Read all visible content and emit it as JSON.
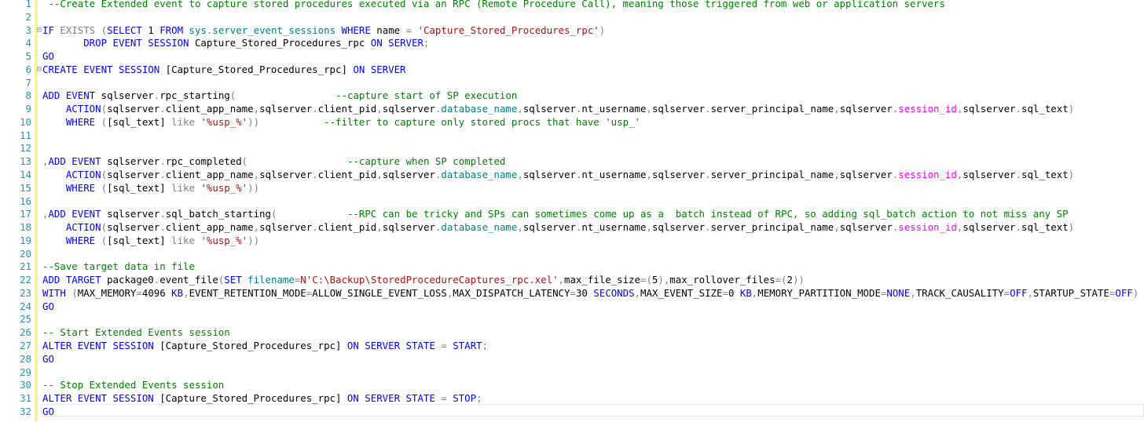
{
  "editor": {
    "lines": [
      {
        "n": "1",
        "parts": [
          {
            "t": " --Create Extended event to capture stored procedures executed via an RPC (Remote Procedure Call), meaning those triggered from web or application servers",
            "c": "cm"
          }
        ]
      },
      {
        "n": "2",
        "parts": []
      },
      {
        "n": "3",
        "fold": "⊟",
        "parts": [
          {
            "t": "IF ",
            "c": "kw"
          },
          {
            "t": "EXISTS ",
            "c": "gr"
          },
          {
            "t": "(",
            "c": "gr"
          },
          {
            "t": "SELECT ",
            "c": "kw"
          },
          {
            "t": "1 ",
            "c": ""
          },
          {
            "t": "FROM ",
            "c": "kw"
          },
          {
            "t": "sys",
            "c": "ob"
          },
          {
            "t": ".",
            "c": "gr"
          },
          {
            "t": "server_event_sessions ",
            "c": "ob"
          },
          {
            "t": "WHERE ",
            "c": "kw"
          },
          {
            "t": "name ",
            "c": ""
          },
          {
            "t": "= ",
            "c": "gr"
          },
          {
            "t": "'Capture_Stored_Procedures_rpc'",
            "c": "st"
          },
          {
            "t": ")",
            "c": "gr"
          }
        ]
      },
      {
        "n": "4",
        "parts": [
          {
            "t": "       DROP EVENT SESSION ",
            "c": "kw"
          },
          {
            "t": "Capture_Stored_Procedures_rpc ",
            "c": ""
          },
          {
            "t": "ON SERVER",
            "c": "kw"
          },
          {
            "t": ";",
            "c": "gr"
          }
        ]
      },
      {
        "n": "5",
        "parts": [
          {
            "t": "GO",
            "c": "kw"
          }
        ]
      },
      {
        "n": "6",
        "fold": "⊟",
        "parts": [
          {
            "t": "CREATE EVENT SESSION ",
            "c": "kw"
          },
          {
            "t": "[Capture_Stored_Procedures_rpc] ",
            "c": ""
          },
          {
            "t": "ON SERVER",
            "c": "kw"
          }
        ]
      },
      {
        "n": "7",
        "parts": []
      },
      {
        "n": "8",
        "parts": [
          {
            "t": "ADD EVENT ",
            "c": "kw"
          },
          {
            "t": "sqlserver",
            "c": ""
          },
          {
            "t": ".",
            "c": "gr"
          },
          {
            "t": "rpc_starting",
            "c": ""
          },
          {
            "t": "(",
            "c": "gr"
          },
          {
            "t": "                 ",
            "c": ""
          },
          {
            "t": "--capture start of SP execution",
            "c": "cm"
          }
        ]
      },
      {
        "n": "9",
        "parts": [
          {
            "t": "    ACTION",
            "c": "kw"
          },
          {
            "t": "(",
            "c": "gr"
          },
          {
            "t": "sqlserver",
            "c": ""
          },
          {
            "t": ".",
            "c": "gr"
          },
          {
            "t": "client_app_name",
            "c": ""
          },
          {
            "t": ",",
            "c": "gr"
          },
          {
            "t": "sqlserver",
            "c": ""
          },
          {
            "t": ".",
            "c": "gr"
          },
          {
            "t": "client_pid",
            "c": ""
          },
          {
            "t": ",",
            "c": "gr"
          },
          {
            "t": "sqlserver",
            "c": ""
          },
          {
            "t": ".",
            "c": "gr"
          },
          {
            "t": "database_name",
            "c": "ob"
          },
          {
            "t": ",",
            "c": "gr"
          },
          {
            "t": "sqlserver",
            "c": ""
          },
          {
            "t": ".",
            "c": "gr"
          },
          {
            "t": "nt_username",
            "c": ""
          },
          {
            "t": ",",
            "c": "gr"
          },
          {
            "t": "sqlserver",
            "c": ""
          },
          {
            "t": ".",
            "c": "gr"
          },
          {
            "t": "server_principal_name",
            "c": ""
          },
          {
            "t": ",",
            "c": "gr"
          },
          {
            "t": "sqlserver",
            "c": ""
          },
          {
            "t": ".",
            "c": "gr"
          },
          {
            "t": "session_id",
            "c": "fn"
          },
          {
            "t": ",",
            "c": "gr"
          },
          {
            "t": "sqlserver",
            "c": ""
          },
          {
            "t": ".",
            "c": "gr"
          },
          {
            "t": "sql_text",
            "c": ""
          },
          {
            "t": ")",
            "c": "gr"
          }
        ]
      },
      {
        "n": "10",
        "parts": [
          {
            "t": "    WHERE ",
            "c": "kw"
          },
          {
            "t": "(",
            "c": "gr"
          },
          {
            "t": "[sql_text] ",
            "c": ""
          },
          {
            "t": "like ",
            "c": "gr"
          },
          {
            "t": "'%usp_%'",
            "c": "st"
          },
          {
            "t": "))",
            "c": "gr"
          },
          {
            "t": "           ",
            "c": ""
          },
          {
            "t": "--filter to capture only stored procs that have 'usp_'",
            "c": "cm"
          }
        ]
      },
      {
        "n": "11",
        "parts": []
      },
      {
        "n": "12",
        "parts": []
      },
      {
        "n": "13",
        "parts": [
          {
            "t": ",",
            "c": "gr"
          },
          {
            "t": "ADD EVENT ",
            "c": "kw"
          },
          {
            "t": "sqlserver",
            "c": ""
          },
          {
            "t": ".",
            "c": "gr"
          },
          {
            "t": "rpc_completed",
            "c": ""
          },
          {
            "t": "(",
            "c": "gr"
          },
          {
            "t": "                 ",
            "c": ""
          },
          {
            "t": "--capture when SP completed",
            "c": "cm"
          }
        ]
      },
      {
        "n": "14",
        "parts": [
          {
            "t": "    ACTION",
            "c": "kw"
          },
          {
            "t": "(",
            "c": "gr"
          },
          {
            "t": "sqlserver",
            "c": ""
          },
          {
            "t": ".",
            "c": "gr"
          },
          {
            "t": "client_app_name",
            "c": ""
          },
          {
            "t": ",",
            "c": "gr"
          },
          {
            "t": "sqlserver",
            "c": ""
          },
          {
            "t": ".",
            "c": "gr"
          },
          {
            "t": "client_pid",
            "c": ""
          },
          {
            "t": ",",
            "c": "gr"
          },
          {
            "t": "sqlserver",
            "c": ""
          },
          {
            "t": ".",
            "c": "gr"
          },
          {
            "t": "database_name",
            "c": "ob"
          },
          {
            "t": ",",
            "c": "gr"
          },
          {
            "t": "sqlserver",
            "c": ""
          },
          {
            "t": ".",
            "c": "gr"
          },
          {
            "t": "nt_username",
            "c": ""
          },
          {
            "t": ",",
            "c": "gr"
          },
          {
            "t": "sqlserver",
            "c": ""
          },
          {
            "t": ".",
            "c": "gr"
          },
          {
            "t": "server_principal_name",
            "c": ""
          },
          {
            "t": ",",
            "c": "gr"
          },
          {
            "t": "sqlserver",
            "c": ""
          },
          {
            "t": ".",
            "c": "gr"
          },
          {
            "t": "session_id",
            "c": "fn"
          },
          {
            "t": ",",
            "c": "gr"
          },
          {
            "t": "sqlserver",
            "c": ""
          },
          {
            "t": ".",
            "c": "gr"
          },
          {
            "t": "sql_text",
            "c": ""
          },
          {
            "t": ")",
            "c": "gr"
          }
        ]
      },
      {
        "n": "15",
        "parts": [
          {
            "t": "    WHERE ",
            "c": "kw"
          },
          {
            "t": "(",
            "c": "gr"
          },
          {
            "t": "[sql_text] ",
            "c": ""
          },
          {
            "t": "like ",
            "c": "gr"
          },
          {
            "t": "'%usp_%'",
            "c": "st"
          },
          {
            "t": "))",
            "c": "gr"
          }
        ]
      },
      {
        "n": "16",
        "parts": []
      },
      {
        "n": "17",
        "parts": [
          {
            "t": ",",
            "c": "gr"
          },
          {
            "t": "ADD EVENT ",
            "c": "kw"
          },
          {
            "t": "sqlserver",
            "c": ""
          },
          {
            "t": ".",
            "c": "gr"
          },
          {
            "t": "sql_batch_starting",
            "c": ""
          },
          {
            "t": "(",
            "c": "gr"
          },
          {
            "t": "            ",
            "c": ""
          },
          {
            "t": "--RPC can be tricky and SPs can sometimes come up as a  batch instead of RPC, so adding sql_batch action to not miss any SP",
            "c": "cm"
          }
        ]
      },
      {
        "n": "18",
        "parts": [
          {
            "t": "    ACTION",
            "c": "kw"
          },
          {
            "t": "(",
            "c": "gr"
          },
          {
            "t": "sqlserver",
            "c": ""
          },
          {
            "t": ".",
            "c": "gr"
          },
          {
            "t": "client_app_name",
            "c": ""
          },
          {
            "t": ",",
            "c": "gr"
          },
          {
            "t": "sqlserver",
            "c": ""
          },
          {
            "t": ".",
            "c": "gr"
          },
          {
            "t": "client_pid",
            "c": ""
          },
          {
            "t": ",",
            "c": "gr"
          },
          {
            "t": "sqlserver",
            "c": ""
          },
          {
            "t": ".",
            "c": "gr"
          },
          {
            "t": "database_name",
            "c": "ob"
          },
          {
            "t": ",",
            "c": "gr"
          },
          {
            "t": "sqlserver",
            "c": ""
          },
          {
            "t": ".",
            "c": "gr"
          },
          {
            "t": "nt_username",
            "c": ""
          },
          {
            "t": ",",
            "c": "gr"
          },
          {
            "t": "sqlserver",
            "c": ""
          },
          {
            "t": ".",
            "c": "gr"
          },
          {
            "t": "server_principal_name",
            "c": ""
          },
          {
            "t": ",",
            "c": "gr"
          },
          {
            "t": "sqlserver",
            "c": ""
          },
          {
            "t": ".",
            "c": "gr"
          },
          {
            "t": "session_id",
            "c": "fn"
          },
          {
            "t": ",",
            "c": "gr"
          },
          {
            "t": "sqlserver",
            "c": ""
          },
          {
            "t": ".",
            "c": "gr"
          },
          {
            "t": "sql_text",
            "c": ""
          },
          {
            "t": ")",
            "c": "gr"
          }
        ]
      },
      {
        "n": "19",
        "parts": [
          {
            "t": "    WHERE ",
            "c": "kw"
          },
          {
            "t": "(",
            "c": "gr"
          },
          {
            "t": "[sql_text] ",
            "c": ""
          },
          {
            "t": "like ",
            "c": "gr"
          },
          {
            "t": "'%usp_%'",
            "c": "st"
          },
          {
            "t": "))",
            "c": "gr"
          }
        ]
      },
      {
        "n": "20",
        "parts": []
      },
      {
        "n": "21",
        "parts": [
          {
            "t": "--Save target data in file",
            "c": "cm"
          }
        ]
      },
      {
        "n": "22",
        "parts": [
          {
            "t": "ADD TARGET ",
            "c": "kw"
          },
          {
            "t": "package0",
            "c": ""
          },
          {
            "t": ".",
            "c": "gr"
          },
          {
            "t": "event_file",
            "c": ""
          },
          {
            "t": "(",
            "c": "gr"
          },
          {
            "t": "SET ",
            "c": "kw"
          },
          {
            "t": "filename",
            "c": "ob"
          },
          {
            "t": "=",
            "c": "gr"
          },
          {
            "t": "N'C:\\Backup\\StoredProcedureCaptures_rpc.xel'",
            "c": "st"
          },
          {
            "t": ",",
            "c": "gr"
          },
          {
            "t": "max_file_size",
            "c": ""
          },
          {
            "t": "=(",
            "c": "gr"
          },
          {
            "t": "5",
            "c": ""
          },
          {
            "t": "),",
            "c": "gr"
          },
          {
            "t": "max_rollover_files",
            "c": ""
          },
          {
            "t": "=(",
            "c": "gr"
          },
          {
            "t": "2",
            "c": ""
          },
          {
            "t": "))",
            "c": "gr"
          }
        ]
      },
      {
        "n": "23",
        "parts": [
          {
            "t": "WITH ",
            "c": "kw"
          },
          {
            "t": "(",
            "c": "gr"
          },
          {
            "t": "MAX_MEMORY",
            "c": ""
          },
          {
            "t": "=",
            "c": "gr"
          },
          {
            "t": "4096 ",
            "c": ""
          },
          {
            "t": "KB",
            "c": "kw"
          },
          {
            "t": ",",
            "c": "gr"
          },
          {
            "t": "EVENT_RETENTION_MODE",
            "c": ""
          },
          {
            "t": "=",
            "c": "gr"
          },
          {
            "t": "ALLOW_SINGLE_EVENT_LOSS",
            "c": ""
          },
          {
            "t": ",",
            "c": "gr"
          },
          {
            "t": "MAX_DISPATCH_LATENCY",
            "c": ""
          },
          {
            "t": "=",
            "c": "gr"
          },
          {
            "t": "30 ",
            "c": ""
          },
          {
            "t": "SECONDS",
            "c": "kw"
          },
          {
            "t": ",",
            "c": "gr"
          },
          {
            "t": "MAX_EVENT_SIZE",
            "c": ""
          },
          {
            "t": "=",
            "c": "gr"
          },
          {
            "t": "0 ",
            "c": ""
          },
          {
            "t": "KB",
            "c": "kw"
          },
          {
            "t": ",",
            "c": "gr"
          },
          {
            "t": "MEMORY_PARTITION_MODE",
            "c": ""
          },
          {
            "t": "=",
            "c": "gr"
          },
          {
            "t": "NONE",
            "c": "kw"
          },
          {
            "t": ",",
            "c": "gr"
          },
          {
            "t": "TRACK_CAUSALITY",
            "c": ""
          },
          {
            "t": "=",
            "c": "gr"
          },
          {
            "t": "OFF",
            "c": "kw"
          },
          {
            "t": ",",
            "c": "gr"
          },
          {
            "t": "STARTUP_STATE",
            "c": ""
          },
          {
            "t": "=",
            "c": "gr"
          },
          {
            "t": "OFF",
            "c": "kw"
          },
          {
            "t": ")",
            "c": "gr"
          }
        ]
      },
      {
        "n": "24",
        "parts": [
          {
            "t": "GO",
            "c": "kw"
          }
        ]
      },
      {
        "n": "25",
        "parts": []
      },
      {
        "n": "26",
        "parts": [
          {
            "t": "-- Start Extended Events session",
            "c": "cm"
          }
        ]
      },
      {
        "n": "27",
        "parts": [
          {
            "t": "ALTER EVENT SESSION ",
            "c": "kw"
          },
          {
            "t": "[Capture_Stored_Procedures_rpc] ",
            "c": ""
          },
          {
            "t": "ON SERVER STATE ",
            "c": "kw"
          },
          {
            "t": "= ",
            "c": "gr"
          },
          {
            "t": "START",
            "c": "kw"
          },
          {
            "t": ";",
            "c": "gr"
          }
        ]
      },
      {
        "n": "28",
        "parts": [
          {
            "t": "GO",
            "c": "kw"
          }
        ]
      },
      {
        "n": "29",
        "parts": []
      },
      {
        "n": "30",
        "parts": [
          {
            "t": "-- Stop Extended Events session",
            "c": "cm"
          }
        ]
      },
      {
        "n": "31",
        "parts": [
          {
            "t": "ALTER EVENT SESSION ",
            "c": "kw"
          },
          {
            "t": "[Capture_Stored_Procedures_rpc] ",
            "c": ""
          },
          {
            "t": "ON SERVER STATE ",
            "c": "kw"
          },
          {
            "t": "= ",
            "c": "gr"
          },
          {
            "t": "STOP",
            "c": "kw"
          },
          {
            "t": ";",
            "c": "gr"
          }
        ]
      },
      {
        "n": "32",
        "parts": [
          {
            "t": "GO",
            "c": "kw"
          }
        ]
      }
    ],
    "colors": {
      "keyword": "#0000ff",
      "comment": "#008000",
      "string": "#a31515",
      "function": "#ff00ff",
      "operator": "#808080",
      "object": "#008080",
      "line_number": "#2b91af",
      "change_bar": "#f6f3a0"
    }
  }
}
